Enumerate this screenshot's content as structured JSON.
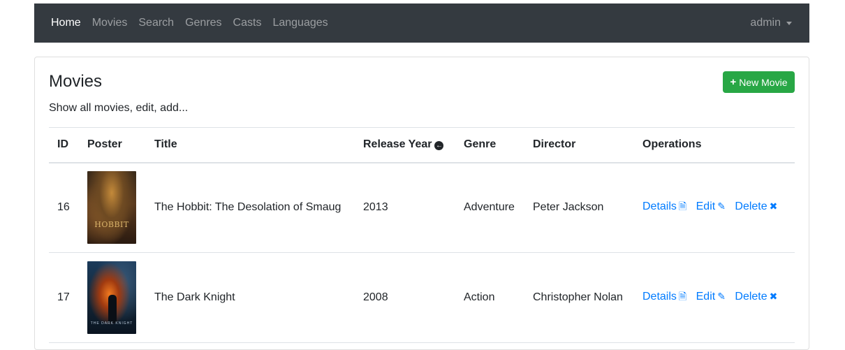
{
  "nav": {
    "items": [
      {
        "label": "Home",
        "active": true
      },
      {
        "label": "Movies",
        "active": false
      },
      {
        "label": "Search",
        "active": false
      },
      {
        "label": "Genres",
        "active": false
      },
      {
        "label": "Casts",
        "active": false
      },
      {
        "label": "Languages",
        "active": false
      }
    ],
    "user": "admin"
  },
  "page": {
    "title": "Movies",
    "subtitle": "Show all movies, edit, add...",
    "new_button": "New Movie"
  },
  "table": {
    "headers": [
      "ID",
      "Poster",
      "Title",
      "Release Year",
      "Genre",
      "Director",
      "Operations"
    ],
    "rows": [
      {
        "id": "16",
        "poster": "hobbit-poster",
        "poster_text": "HOBBIT",
        "title": "The Hobbit: The Desolation of Smaug",
        "year": "2013",
        "genre": "Adventure",
        "director": "Peter Jackson"
      },
      {
        "id": "17",
        "poster": "dark-knight-poster",
        "poster_text": "THE DARK KNIGHT",
        "title": "The Dark Knight",
        "year": "2008",
        "genre": "Action",
        "director": "Christopher Nolan"
      }
    ],
    "operations": {
      "details": "Details",
      "edit": "Edit",
      "delete": "Delete"
    }
  },
  "colors": {
    "navbar": "#343a40",
    "accent": "#007bff",
    "success": "#28a745"
  },
  "icons": {
    "sort": "arrow-circle-left-icon",
    "details": "file-text-icon",
    "edit": "edit-icon",
    "delete": "x-icon",
    "new": "plus-icon"
  }
}
